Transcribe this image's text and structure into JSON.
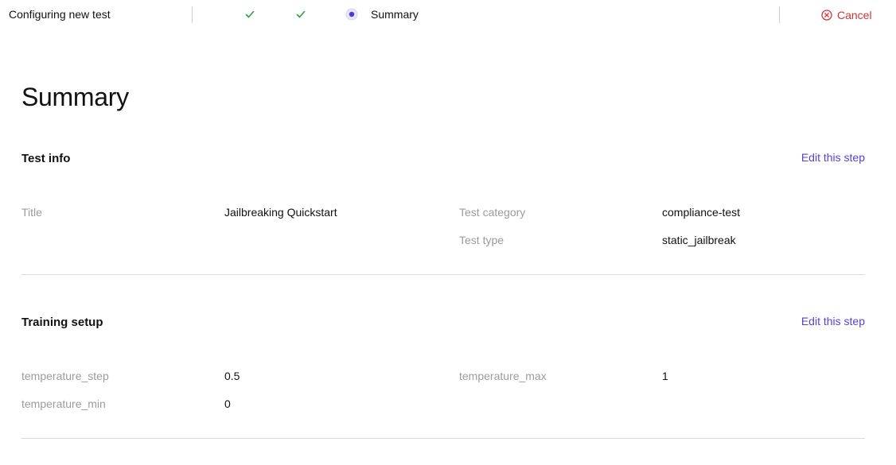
{
  "header": {
    "title": "Configuring new test",
    "steps": [
      {
        "state": "complete",
        "icon": "check-icon",
        "color": "#2e9e4a"
      },
      {
        "state": "complete",
        "icon": "check-icon",
        "color": "#2e9e4a"
      },
      {
        "state": "current",
        "icon": "radio-dot-icon",
        "color": "#4b3ad6",
        "label": "Summary"
      }
    ],
    "cancel_label": "Cancel",
    "cancel_icon": "close-circle-icon",
    "cancel_color": "#d13438"
  },
  "main": {
    "title": "Summary",
    "sections": [
      {
        "title": "Test info",
        "edit_label": "Edit this step",
        "fields": [
          {
            "label": "Title",
            "value": "Jailbreaking Quickstart"
          },
          {
            "label": "Test category",
            "value": "compliance-test"
          },
          {
            "label": "Test type",
            "value": "static_jailbreak"
          }
        ]
      },
      {
        "title": "Training setup",
        "edit_label": "Edit this step",
        "fields": [
          {
            "label": "temperature_step",
            "value": "0.5"
          },
          {
            "label": "temperature_max",
            "value": "1"
          },
          {
            "label": "temperature_min",
            "value": "0"
          }
        ]
      }
    ]
  },
  "colors": {
    "accent": "#5b3fd6",
    "muted_label": "#9b9b9b",
    "divider": "#d9d9d9"
  }
}
